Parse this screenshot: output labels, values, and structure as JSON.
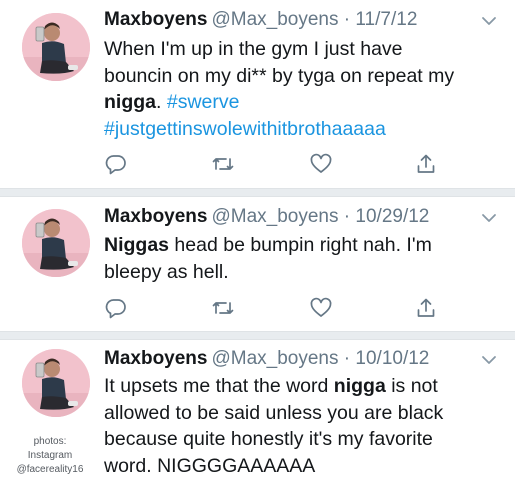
{
  "tweets": [
    {
      "name": "Maxboyens",
      "handle": "@Max_boyens",
      "date": "· 11/7/12",
      "lines": [
        [
          {
            "t": "When I'm up in the gym I just have"
          }
        ],
        [
          {
            "t": "bouncin on my di** by tyga on repeat my"
          }
        ],
        [
          {
            "t": "nigga",
            "s": "b"
          },
          {
            "t": ". "
          },
          {
            "t": "#swerve",
            "s": "tag"
          }
        ],
        [
          {
            "t": "#justgettinswolewithitbrothaaaaa",
            "s": "tag"
          }
        ]
      ]
    },
    {
      "name": "Maxboyens",
      "handle": "@Max_boyens",
      "date": "· 10/29/12",
      "lines": [
        [
          {
            "t": "Niggas",
            "s": "b"
          },
          {
            "t": " head be bumpin right nah. I'm"
          }
        ],
        [
          {
            "t": "bleepy as hell."
          }
        ]
      ]
    },
    {
      "name": "Maxboyens",
      "handle": "@Max_boyens",
      "date": "· 10/10/12",
      "lines": [
        [
          {
            "t": "It upsets me that the word "
          },
          {
            "t": "nigga",
            "s": "b"
          },
          {
            "t": " is not"
          }
        ],
        [
          {
            "t": "allowed to be said unless you are black"
          }
        ],
        [
          {
            "t": "because quite honestly it's my favorite"
          }
        ],
        [
          {
            "t": "word. NIGGGGAAAAAA"
          }
        ]
      ]
    }
  ],
  "icons": {
    "reply": "reply-icon",
    "retweet": "retweet-icon",
    "like": "heart-icon",
    "share": "share-icon",
    "menu": "chevron-down-icon"
  },
  "credit": {
    "line1": "photos:",
    "line2": "Instagram",
    "line3": "@facereality16"
  },
  "colors": {
    "text": "#14171a",
    "secondary": "#657786",
    "link": "#1b95e0",
    "divider": "#e8ecef",
    "avatar_bg": "#f5c7d2"
  }
}
